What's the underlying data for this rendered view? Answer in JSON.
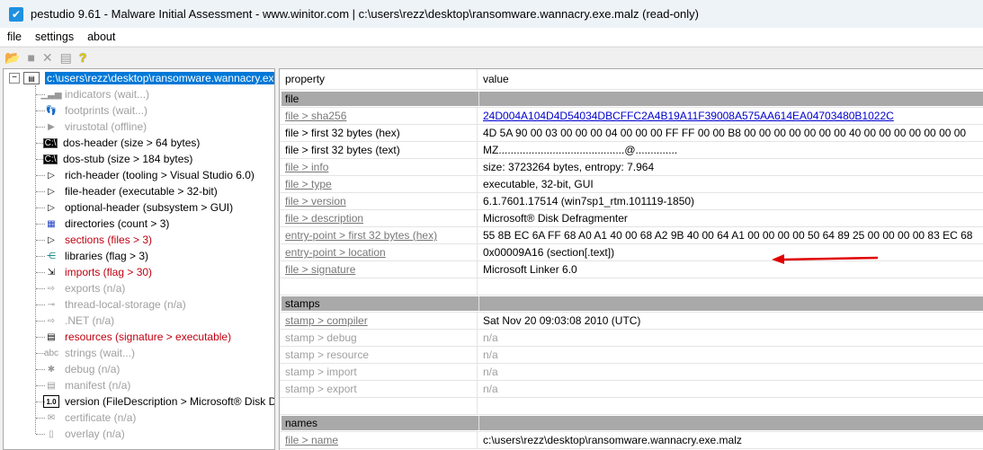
{
  "window": {
    "title": "pestudio 9.61 - Malware Initial Assessment - www.winitor.com | c:\\users\\rezz\\desktop\\ransomware.wannacry.exe.malz (read-only)"
  },
  "menu": [
    "file",
    "settings",
    "about"
  ],
  "toolbar": {
    "icons": [
      "open-folder-icon",
      "save-icon",
      "close-icon",
      "clipboard-icon",
      "help-icon"
    ],
    "help_glyph": "?"
  },
  "tree": {
    "root": "c:\\users\\rezz\\desktop\\ransomware.wannacry.exe",
    "items": [
      {
        "label": "indicators (wait...)",
        "state": "gray",
        "icon": "bar-chart-icon",
        "glyph": "▁▃▅"
      },
      {
        "label": "footprints (wait...)",
        "state": "gray",
        "icon": "footprints-icon",
        "glyph": "👣"
      },
      {
        "label": "virustotal (offline)",
        "state": "gray",
        "icon": "virustotal-icon",
        "glyph": "▶"
      },
      {
        "label": "dos-header (size > 64 bytes)",
        "state": "normal",
        "icon": "console-icon",
        "glyph": "C:\\"
      },
      {
        "label": "dos-stub (size > 184 bytes)",
        "state": "normal",
        "icon": "console-icon",
        "glyph": "C:\\"
      },
      {
        "label": "rich-header (tooling > Visual Studio 6.0)",
        "state": "normal",
        "icon": "triangle-icon",
        "glyph": "▷"
      },
      {
        "label": "file-header (executable > 32-bit)",
        "state": "normal",
        "icon": "triangle-icon",
        "glyph": "▷"
      },
      {
        "label": "optional-header (subsystem > GUI)",
        "state": "normal",
        "icon": "triangle-icon",
        "glyph": "▷"
      },
      {
        "label": "directories (count > 3)",
        "state": "normal",
        "icon": "directories-icon",
        "glyph": "▦"
      },
      {
        "label": "sections (files > 3)",
        "state": "red",
        "icon": "triangle-icon",
        "glyph": "▷"
      },
      {
        "label": "libraries (flag > 3)",
        "state": "normal",
        "icon": "libraries-icon",
        "glyph": "⋲"
      },
      {
        "label": "imports (flag > 30)",
        "state": "red",
        "icon": "imports-icon",
        "glyph": "⇲"
      },
      {
        "label": "exports (n/a)",
        "state": "gray",
        "icon": "exports-icon",
        "glyph": "⇨"
      },
      {
        "label": "thread-local-storage (n/a)",
        "state": "gray",
        "icon": "key-icon",
        "glyph": "⊸"
      },
      {
        "label": ".NET (n/a)",
        "state": "gray",
        "icon": "dotnet-icon",
        "glyph": "⇨"
      },
      {
        "label": "resources (signature > executable)",
        "state": "red",
        "icon": "resources-icon",
        "glyph": "▤"
      },
      {
        "label": "strings (wait...)",
        "state": "gray",
        "icon": "strings-icon",
        "glyph": "abc"
      },
      {
        "label": "debug (n/a)",
        "state": "gray",
        "icon": "bug-icon",
        "glyph": "✱"
      },
      {
        "label": "manifest (n/a)",
        "state": "gray",
        "icon": "manifest-icon",
        "glyph": "▤"
      },
      {
        "label": "version (FileDescription > Microsoft® Disk Defragmenter)",
        "state": "normal",
        "icon": "version-icon",
        "glyph": "1.0"
      },
      {
        "label": "certificate (n/a)",
        "state": "gray",
        "icon": "certificate-icon",
        "glyph": "✉"
      },
      {
        "label": "overlay (n/a)",
        "state": "gray",
        "icon": "file-icon",
        "glyph": "▯"
      }
    ]
  },
  "grid": {
    "columns": [
      "property",
      "value"
    ],
    "rows": [
      {
        "type": "section",
        "p": "file",
        "v": ""
      },
      {
        "type": "link",
        "p": "file > sha256",
        "v": "24D004A104D4D54034DBCFFC2A4B19A11F39008A575AA614EA04703480B1022C",
        "hash": true
      },
      {
        "type": "plain",
        "p": "file > first 32 bytes (hex)",
        "v": "4D 5A 90 00 03 00 00 00 04 00 00 00 FF FF 00 00 B8 00 00 00 00 00 00 00 40 00 00 00 00 00 00 00"
      },
      {
        "type": "plain",
        "p": "file > first 32 bytes (text)",
        "v": "MZ..........................................@.............."
      },
      {
        "type": "link",
        "p": "file > info",
        "v": "size: 3723264 bytes, entropy: 7.964"
      },
      {
        "type": "link",
        "p": "file > type",
        "v": "executable, 32-bit, GUI"
      },
      {
        "type": "link",
        "p": "file > version",
        "v": "6.1.7601.17514 (win7sp1_rtm.101119-1850)"
      },
      {
        "type": "link",
        "p": "file > description",
        "v": "Microsoft® Disk Defragmenter"
      },
      {
        "type": "link",
        "p": "entry-point > first 32 bytes (hex)",
        "v": "55 8B EC 6A FF 68 A0 A1 40 00 68 A2 9B 40 00 64 A1 00 00 00 00 50 64 89 25 00 00 00 00 83 EC 68"
      },
      {
        "type": "link",
        "p": "entry-point > location",
        "v": "0x00009A16 (section[.text])"
      },
      {
        "type": "link",
        "p": "file > signature",
        "v": "Microsoft Linker 6.0"
      },
      {
        "type": "blank",
        "p": "",
        "v": ""
      },
      {
        "type": "section",
        "p": "stamps",
        "v": ""
      },
      {
        "type": "link",
        "p": "stamp > compiler",
        "v": "Sat Nov 20 09:03:08 2010 (UTC)"
      },
      {
        "type": "gray",
        "p": "stamp > debug",
        "v": "n/a"
      },
      {
        "type": "gray",
        "p": "stamp > resource",
        "v": "n/a"
      },
      {
        "type": "gray",
        "p": "stamp > import",
        "v": "n/a"
      },
      {
        "type": "gray",
        "p": "stamp > export",
        "v": "n/a"
      },
      {
        "type": "blank",
        "p": "",
        "v": ""
      },
      {
        "type": "section",
        "p": "names",
        "v": ""
      },
      {
        "type": "link",
        "p": "file > name",
        "v": "c:\\users\\rezz\\desktop\\ransomware.wannacry.exe.malz"
      }
    ]
  },
  "annotation": {
    "arrow_color": "#e00000",
    "points_to": "file > type"
  }
}
